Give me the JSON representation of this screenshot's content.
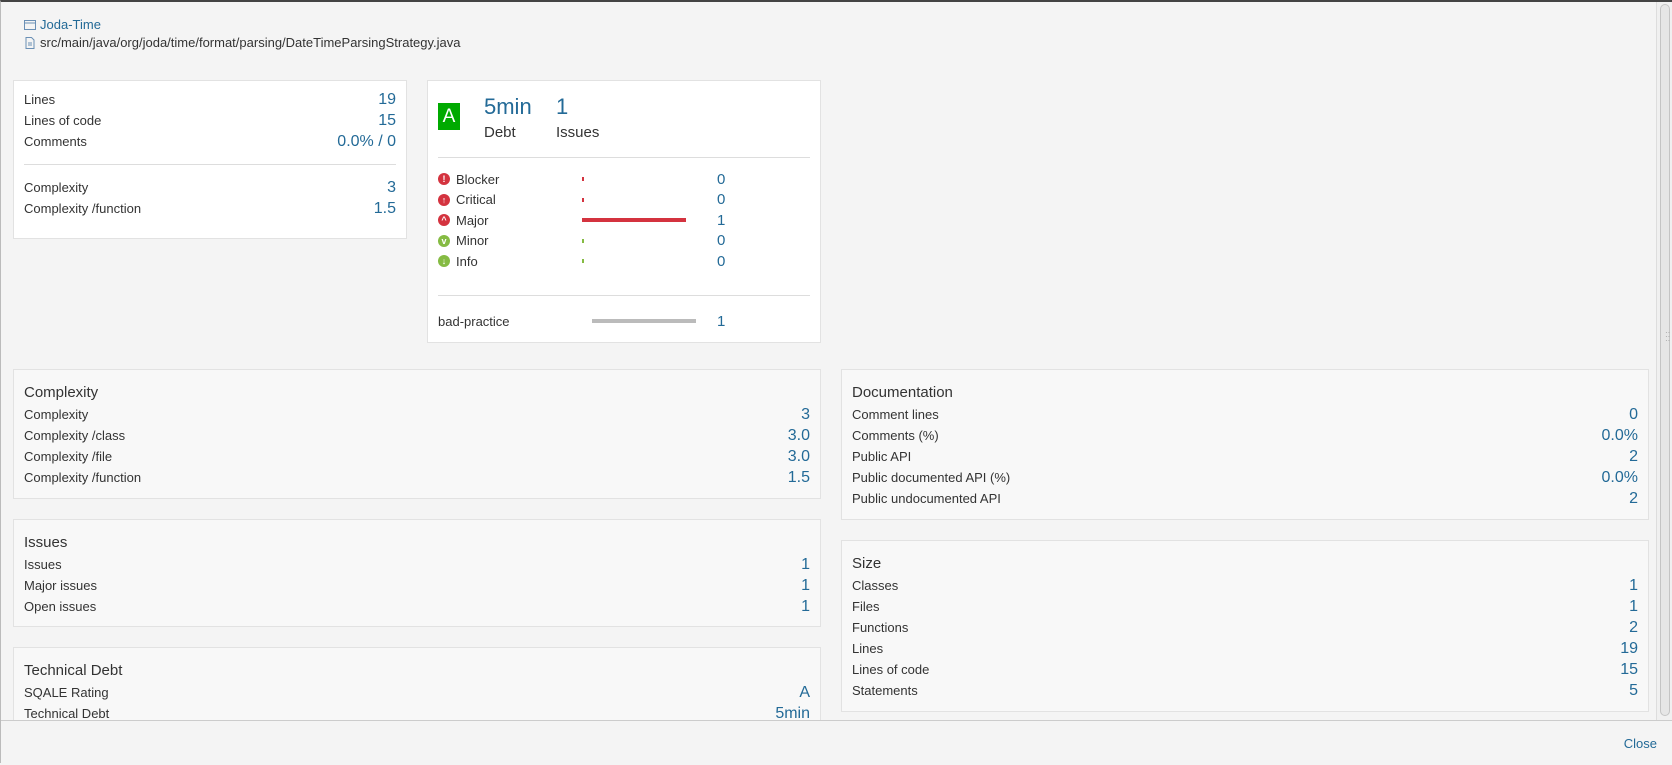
{
  "header": {
    "project": "Joda-Time",
    "path": "src/main/java/org/joda/time/format/parsing/DateTimeParsingStrategy.java"
  },
  "summary": {
    "top": [
      {
        "label": "Lines",
        "value": "19"
      },
      {
        "label": "Lines of code",
        "value": "15"
      },
      {
        "label": "Comments",
        "value": "0.0% / 0"
      }
    ],
    "bottom": [
      {
        "label": "Complexity",
        "value": "3"
      },
      {
        "label": "Complexity /function",
        "value": "1.5"
      }
    ]
  },
  "issues_panel": {
    "rating": "A",
    "debt_value": "5min",
    "debt_label": "Debt",
    "issues_value": "1",
    "issues_label": "Issues",
    "severities": [
      {
        "label": "Blocker",
        "value": "0",
        "fraction": 0,
        "icon": "blocker-icon",
        "color": "#d4333f"
      },
      {
        "label": "Critical",
        "value": "0",
        "fraction": 0,
        "icon": "critical-icon",
        "color": "#d4333f"
      },
      {
        "label": "Major",
        "value": "1",
        "fraction": 1,
        "icon": "major-icon",
        "color": "#d4333f"
      },
      {
        "label": "Minor",
        "value": "0",
        "fraction": 0,
        "icon": "minor-icon",
        "color": "#85bb43"
      },
      {
        "label": "Info",
        "value": "0",
        "fraction": 0,
        "icon": "info-icon",
        "color": "#85bb43"
      }
    ],
    "tag": {
      "label": "bad-practice",
      "value": "1",
      "fraction": 1
    }
  },
  "complexity": {
    "title": "Complexity",
    "rows": [
      {
        "label": "Complexity",
        "value": "3"
      },
      {
        "label": "Complexity /class",
        "value": "3.0"
      },
      {
        "label": "Complexity /file",
        "value": "3.0"
      },
      {
        "label": "Complexity /function",
        "value": "1.5"
      }
    ]
  },
  "issues": {
    "title": "Issues",
    "rows": [
      {
        "label": "Issues",
        "value": "1"
      },
      {
        "label": "Major issues",
        "value": "1"
      },
      {
        "label": "Open issues",
        "value": "1"
      }
    ]
  },
  "technical_debt": {
    "title": "Technical Debt",
    "rows": [
      {
        "label": "SQALE Rating",
        "value": "A"
      },
      {
        "label": "Technical Debt",
        "value": "5min"
      }
    ]
  },
  "documentation": {
    "title": "Documentation",
    "rows": [
      {
        "label": "Comment lines",
        "value": "0"
      },
      {
        "label": "Comments (%)",
        "value": "0.0%"
      },
      {
        "label": "Public API",
        "value": "2"
      },
      {
        "label": "Public documented API (%)",
        "value": "0.0%"
      },
      {
        "label": "Public undocumented API",
        "value": "2"
      }
    ]
  },
  "size": {
    "title": "Size",
    "rows": [
      {
        "label": "Classes",
        "value": "1"
      },
      {
        "label": "Files",
        "value": "1"
      },
      {
        "label": "Functions",
        "value": "2"
      },
      {
        "label": "Lines",
        "value": "19"
      },
      {
        "label": "Lines of code",
        "value": "15"
      },
      {
        "label": "Statements",
        "value": "5"
      }
    ]
  },
  "footer": {
    "close_label": "Close"
  },
  "colors": {
    "link": "#236a97",
    "rating_a": "#00aa00",
    "bar_major": "#d4333f",
    "bar_tag": "#bbbbbb"
  }
}
